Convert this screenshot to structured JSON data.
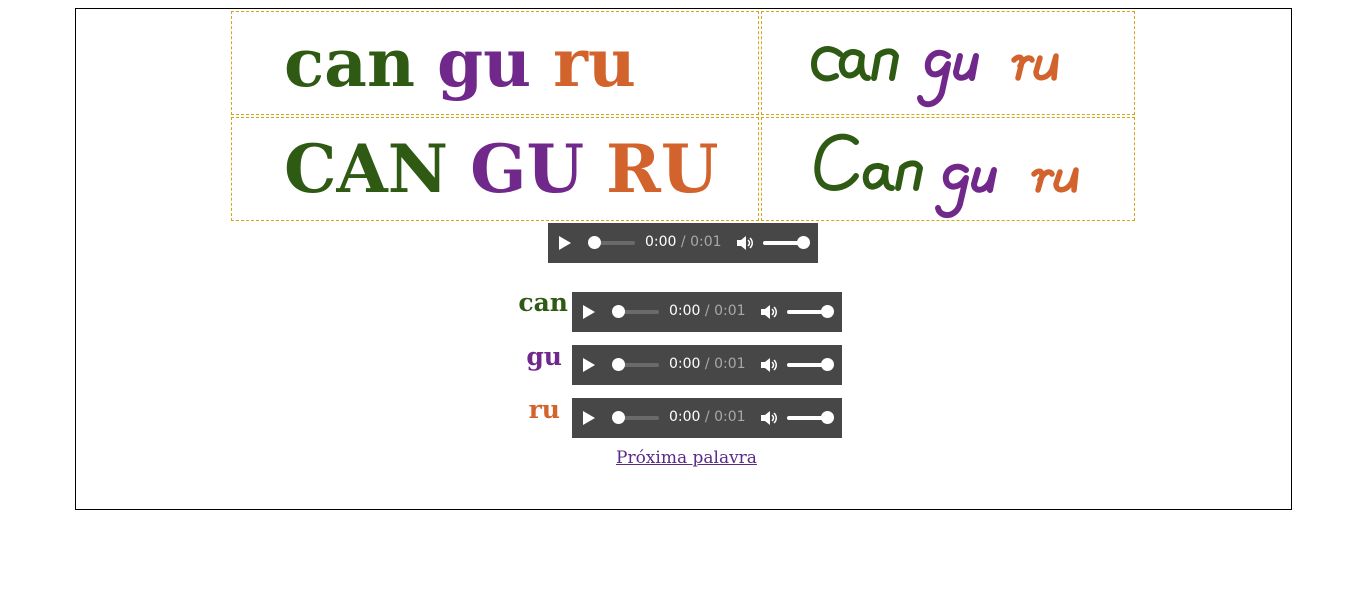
{
  "word_lower": [
    {
      "text": "can",
      "color": "#2f5a14"
    },
    {
      "text": "gu",
      "color": "#71288b"
    },
    {
      "text": "ru",
      "color": "#d2632c"
    }
  ],
  "word_upper": [
    {
      "text": "CAN",
      "color": "#2f5a14"
    },
    {
      "text": "GU",
      "color": "#71288b"
    },
    {
      "text": "RU",
      "color": "#d2632c"
    }
  ],
  "cursive_lower": [
    "can",
    "gu",
    "ru"
  ],
  "cursive_capital": [
    "Can",
    "gu",
    "ru"
  ],
  "full_player": {
    "current": "0:00",
    "duration": "/ 0:01",
    "progress": 0,
    "volume": 1
  },
  "syllables": [
    {
      "label": "can",
      "color": "#2f5a14",
      "player": {
        "current": "0:00",
        "duration": "/ 0:01",
        "progress": 0,
        "volume": 1
      }
    },
    {
      "label": "gu",
      "color": "#71288b",
      "player": {
        "current": "0:00",
        "duration": "/ 0:01",
        "progress": 0,
        "volume": 1
      }
    },
    {
      "label": "ru",
      "color": "#d2632c",
      "player": {
        "current": "0:00",
        "duration": "/ 0:01",
        "progress": 0,
        "volume": 1
      }
    }
  ],
  "next_link": "Próxima palavra",
  "icons": {
    "play": "play-icon",
    "volume": "volume-icon"
  }
}
